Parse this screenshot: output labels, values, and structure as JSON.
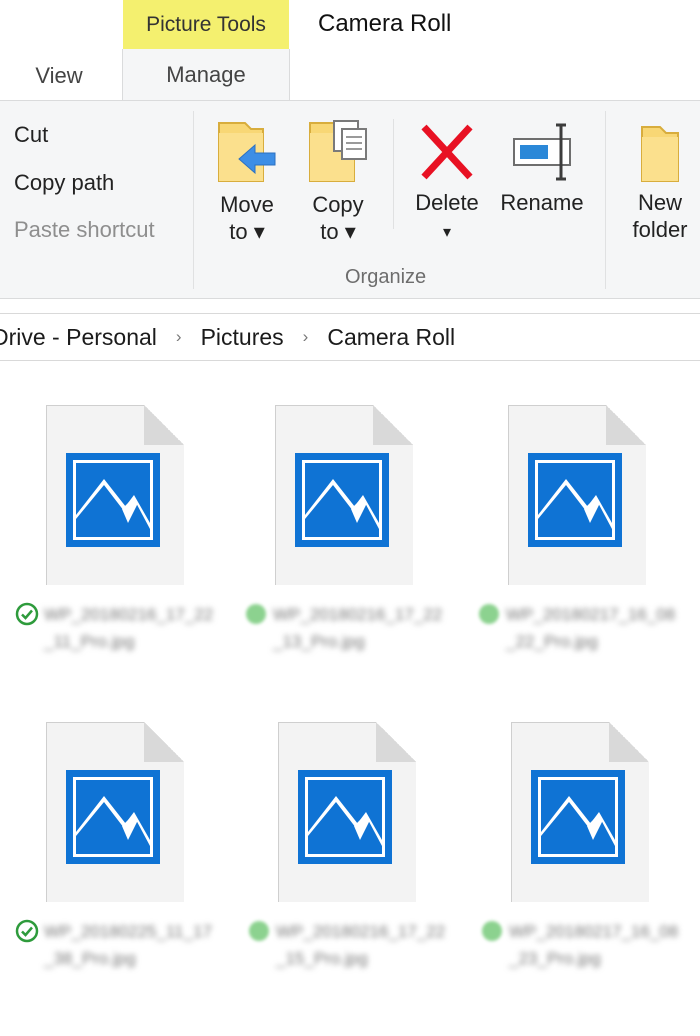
{
  "tabs": {
    "context_header": "Picture Tools",
    "window_title": "Camera Roll",
    "view": "View",
    "manage": "Manage"
  },
  "ribbon": {
    "clipboard": {
      "cut": "Cut",
      "copy_path": "Copy path",
      "paste_shortcut": "Paste shortcut"
    },
    "organize": {
      "move_to": [
        "Move",
        "to ▾"
      ],
      "copy_to": [
        "Copy",
        "to ▾"
      ],
      "delete": "Delete",
      "delete_arrow": "▾",
      "rename": "Rename",
      "group_label": "Organize"
    },
    "new": {
      "new_folder": [
        "New",
        "folder"
      ]
    }
  },
  "address": {
    "crumbs": [
      "Drive - Personal",
      "Pictures",
      "Camera Roll"
    ],
    "separator": "›"
  },
  "files": [
    {
      "name": "WP_20180216_17_22_11_Pro.jpg",
      "status": "synced"
    },
    {
      "name": "WP_20180216_17_22_13_Pro.jpg",
      "status": "cloud"
    },
    {
      "name": "WP_20180217_16_08_22_Pro.jpg",
      "status": "cloud"
    },
    {
      "name": "WP_20180225_11_17_38_Pro.jpg",
      "status": "synced"
    },
    {
      "name": "WP_20180216_17_22_15_Pro.jpg",
      "status": "cloud"
    },
    {
      "name": "WP_20180217_16_08_23_Pro.jpg",
      "status": "cloud"
    }
  ],
  "icons": {
    "cut": "scissors-icon",
    "copy_path": "copy-path-icon",
    "paste_shortcut": "paste-shortcut-icon",
    "move_to": "move-to-folder-icon",
    "copy_to": "copy-to-folder-icon",
    "delete": "delete-x-icon",
    "rename": "rename-icon",
    "new_folder": "new-folder-icon",
    "file_thumb": "image-file-icon",
    "status_synced": "sync-check-icon",
    "status_cloud": "cloud-status-icon"
  },
  "colors": {
    "context_tab": "#f4f06f",
    "ribbon_bg": "#f5f6f7",
    "accent_blue": "#0f73d4",
    "delete_red": "#e81123",
    "folder_yellow": "#f8d775",
    "status_green": "#2e9b3c"
  }
}
